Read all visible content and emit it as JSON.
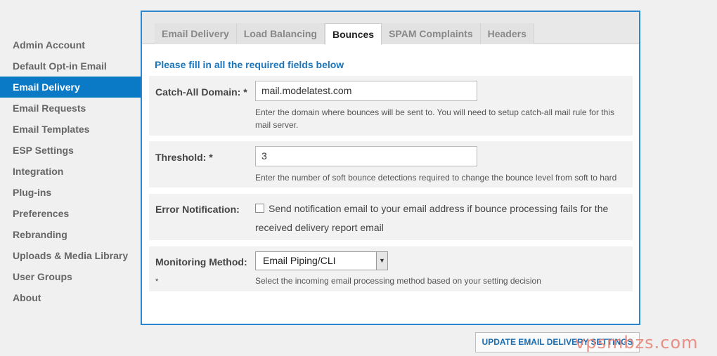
{
  "sidebar": {
    "items": [
      {
        "label": "Admin Account"
      },
      {
        "label": "Default Opt-in Email"
      },
      {
        "label": "Email Delivery"
      },
      {
        "label": "Email Requests"
      },
      {
        "label": "Email Templates"
      },
      {
        "label": "ESP Settings"
      },
      {
        "label": "Integration"
      },
      {
        "label": "Plug-ins"
      },
      {
        "label": "Preferences"
      },
      {
        "label": "Rebranding"
      },
      {
        "label": "Uploads & Media Library"
      },
      {
        "label": "User Groups"
      },
      {
        "label": "About"
      }
    ],
    "active": "Email Delivery"
  },
  "tabs": {
    "items": [
      {
        "label": "Email Delivery"
      },
      {
        "label": "Load Balancing"
      },
      {
        "label": "Bounces"
      },
      {
        "label": "SPAM Complaints"
      },
      {
        "label": "Headers"
      }
    ],
    "active": "Bounces"
  },
  "form": {
    "notice": "Please fill in all the required fields below",
    "catchall": {
      "label": "Catch-All Domain: *",
      "value": "mail.modelatest.com",
      "help": "Enter the domain where bounces will be sent to. You will need to setup catch-all mail rule for this mail server."
    },
    "threshold": {
      "label": "Threshold: *",
      "value": "3",
      "help": "Enter the number of soft bounce detections required to change the bounce level from soft to hard"
    },
    "error_notification": {
      "label": "Error Notification:",
      "checkbox_text": "Send notification email to your email address if bounce processing fails for the received delivery report email",
      "checked": false
    },
    "monitoring": {
      "label": "Monitoring Method:",
      "required_mark": "*",
      "selected": "Email Piping/CLI",
      "help": "Select the incoming email processing method based on your setting decision"
    }
  },
  "actions": {
    "update_label": "UPDATE EMAIL DELIVERY SETTINGS"
  },
  "watermark": "vpsmbzs.com",
  "colors": {
    "accent": "#0a79c6",
    "panel_border": "#2a86cf",
    "link": "#1a75bb",
    "watermark": "#e8857a"
  }
}
